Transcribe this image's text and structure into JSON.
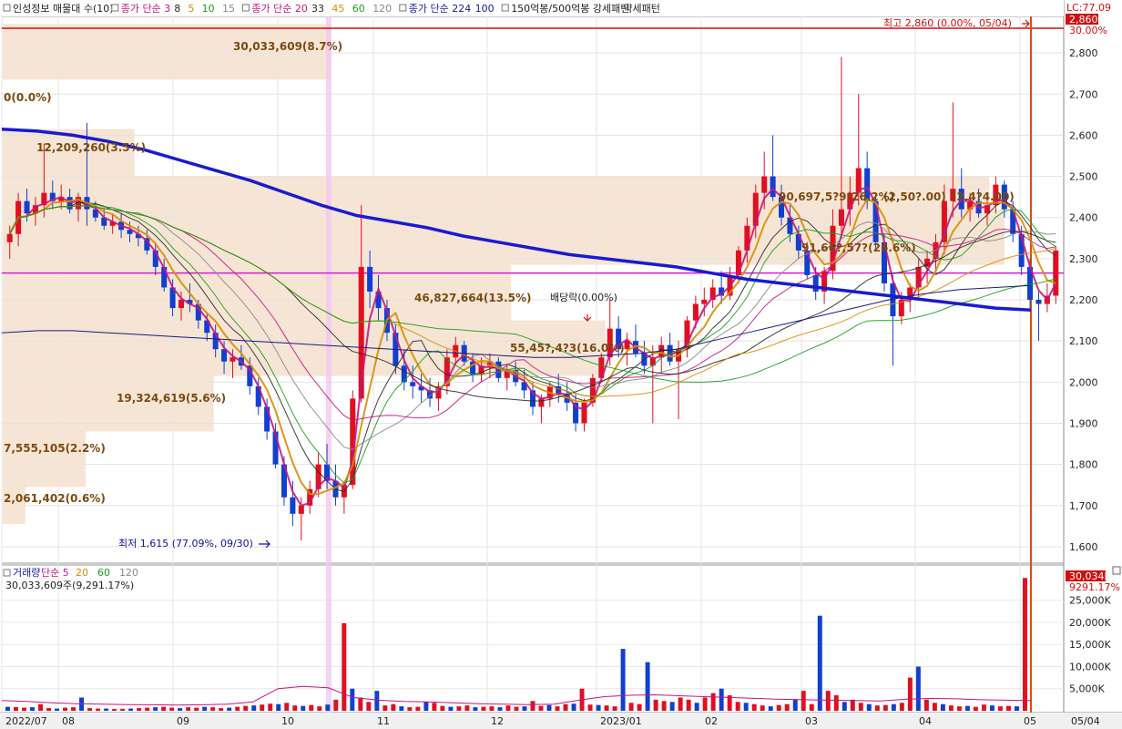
{
  "legend": {
    "main": [
      {
        "text": "인성정보 매물대 수(10)",
        "color": "#222222"
      },
      {
        "text": "종가 단순 3",
        "color": "#c8157f"
      },
      {
        "text": "8",
        "color": "#2a2a2a"
      },
      {
        "text": "5",
        "color": "#d98c00"
      },
      {
        "text": "10",
        "color": "#1a9e1a"
      },
      {
        "text": "15",
        "color": "#888888"
      },
      {
        "text": "종가 단순 20",
        "color": "#c8157f"
      },
      {
        "text": "33",
        "color": "#2a2a2a"
      },
      {
        "text": "45",
        "color": "#d98c00"
      },
      {
        "text": "60",
        "color": "#1a9e1a"
      },
      {
        "text": "120",
        "color": "#888888"
      },
      {
        "text": "종가 단순 224",
        "color": "#1a1aa0"
      },
      {
        "text": "100",
        "color": "#1a1aa0"
      },
      {
        "text": "150억봉/500억봉 강세패턴",
        "color": "#222222"
      },
      {
        "text": "약세패턴",
        "color": "#222222"
      }
    ],
    "volume": [
      {
        "text": "거래량",
        "color": "#1a1a9e"
      },
      {
        "text": "단순 5",
        "color": "#c8157f"
      },
      {
        "text": "20",
        "color": "#d98c00"
      },
      {
        "text": "60",
        "color": "#1a9e1a"
      },
      {
        "text": "120",
        "color": "#888888"
      }
    ],
    "volume_value": "30,033,609주(9,291.17%)"
  },
  "annotations": {
    "lc": "LC:77.09",
    "high_label": "최고 2,860 (0.00%, 05/04)",
    "low_label": "최저 1,615 (77.09%, 09/30)",
    "dividend": "배당락(0.00%)",
    "current_price": "2,860",
    "current_pct": "30.00%",
    "current_volume": "30,034K",
    "current_volume_pct": "9291.17%"
  },
  "chart_data": [
    {
      "type": "candlestick",
      "title": "인성정보 매물대 수(10)",
      "x_labels": [
        "2022/07",
        "08",
        "09",
        "10",
        "11",
        "12",
        "2023/01",
        "02",
        "03",
        "04",
        "05"
      ],
      "y_ticks": [
        1600,
        1700,
        1800,
        1900,
        2000,
        2100,
        2200,
        2300,
        2400,
        2500,
        2600,
        2700,
        2800
      ],
      "y_tick_labels": [
        "1,600",
        "1,700",
        "1,800",
        "1,900",
        "2,000",
        "2,100",
        "2,200",
        "2,300",
        "2,400",
        "2,500",
        "2,600",
        "2,700",
        "2,800"
      ],
      "ylim": [
        1560,
        2880
      ],
      "reference_lines": [
        {
          "name": "high",
          "value": 2860,
          "color": "#d01010"
        },
        {
          "name": "reference",
          "value": 2265,
          "color": "#d020d0"
        }
      ],
      "volume_profile": [
        {
          "label": "2,061,402(0.6%)",
          "price_from": 1655,
          "price_to": 1745,
          "share": 0.6
        },
        {
          "label": "7,555,105(2.2%)",
          "price_from": 1745,
          "price_to": 1880,
          "share": 2.2
        },
        {
          "label": "19,324,619(5.6%)",
          "price_from": 1880,
          "price_to": 2015,
          "share": 5.6
        },
        {
          "label": "55,45?,4?3(16.0%)",
          "price_from": 2015,
          "price_to": 2150,
          "share": 16.0
        },
        {
          "label": "46,827,664(13.5%)",
          "price_from": 2150,
          "price_to": 2285,
          "share": 13.5
        },
        {
          "label": "91,66?,57?(26.6%)",
          "price_from": 2285,
          "price_to": 2420,
          "share": 26.6
        },
        {
          "label": "90,697,5?9(26.2%)",
          "price_from": 2420,
          "price_to": 2500,
          "share": 26.2
        },
        {
          "label": "12,209,260(3.5%)",
          "price_from": 2500,
          "price_to": 2615,
          "share": 3.5
        },
        {
          "label": "0(0.0%)",
          "price_from": 2615,
          "price_to": 2735,
          "share": 0.0
        },
        {
          "label": "30,033,609(8.7%)",
          "price_from": 2735,
          "price_to": 2870,
          "share": 8.7
        }
      ],
      "profile_price_labels": [
        "(2,50?.00)",
        "(2,4?4.00)"
      ],
      "candles": [
        [
          2340,
          2380,
          2300,
          2360
        ],
        [
          2360,
          2460,
          2330,
          2440
        ],
        [
          2440,
          2470,
          2390,
          2410
        ],
        [
          2410,
          2450,
          2380,
          2430
        ],
        [
          2430,
          2580,
          2400,
          2460
        ],
        [
          2460,
          2490,
          2420,
          2440
        ],
        [
          2440,
          2480,
          2420,
          2450
        ],
        [
          2450,
          2470,
          2410,
          2420
        ],
        [
          2420,
          2460,
          2390,
          2450
        ],
        [
          2450,
          2630,
          2380,
          2420
        ],
        [
          2420,
          2440,
          2390,
          2400
        ],
        [
          2400,
          2420,
          2370,
          2380
        ],
        [
          2380,
          2410,
          2360,
          2390
        ],
        [
          2390,
          2410,
          2350,
          2370
        ],
        [
          2370,
          2390,
          2340,
          2360
        ],
        [
          2360,
          2380,
          2330,
          2350
        ],
        [
          2350,
          2370,
          2310,
          2320
        ],
        [
          2320,
          2340,
          2260,
          2280
        ],
        [
          2280,
          2300,
          2220,
          2230
        ],
        [
          2230,
          2250,
          2160,
          2180
        ],
        [
          2180,
          2220,
          2150,
          2200
        ],
        [
          2200,
          2240,
          2170,
          2190
        ],
        [
          2190,
          2200,
          2130,
          2150
        ],
        [
          2150,
          2170,
          2100,
          2120
        ],
        [
          2120,
          2140,
          2060,
          2080
        ],
        [
          2080,
          2100,
          2020,
          2050
        ],
        [
          2050,
          2080,
          2010,
          2060
        ],
        [
          2060,
          2090,
          2030,
          2040
        ],
        [
          2040,
          2060,
          1970,
          1990
        ],
        [
          1990,
          2010,
          1920,
          1940
        ],
        [
          1940,
          1960,
          1860,
          1880
        ],
        [
          1880,
          1900,
          1790,
          1800
        ],
        [
          1800,
          1820,
          1700,
          1720
        ],
        [
          1720,
          1760,
          1650,
          1680
        ],
        [
          1680,
          1720,
          1615,
          1700
        ],
        [
          1700,
          1760,
          1680,
          1740
        ],
        [
          1740,
          1830,
          1720,
          1800
        ],
        [
          1800,
          1850,
          1740,
          1760
        ],
        [
          1760,
          1800,
          1700,
          1720
        ],
        [
          1720,
          1760,
          1680,
          1750
        ],
        [
          1750,
          1980,
          1740,
          1960
        ],
        [
          1960,
          2430,
          1950,
          2280
        ],
        [
          2280,
          2320,
          2180,
          2220
        ],
        [
          2220,
          2260,
          2150,
          2180
        ],
        [
          2180,
          2200,
          2100,
          2120
        ],
        [
          2120,
          2140,
          2020,
          2040
        ],
        [
          2040,
          2080,
          1980,
          2000
        ],
        [
          2000,
          2040,
          1960,
          1990
        ],
        [
          1990,
          2020,
          1950,
          1980
        ],
        [
          1980,
          2010,
          1940,
          1960
        ],
        [
          1960,
          2000,
          1930,
          1990
        ],
        [
          1990,
          2080,
          1970,
          2060
        ],
        [
          2060,
          2110,
          2040,
          2090
        ],
        [
          2090,
          2100,
          2040,
          2050
        ],
        [
          2050,
          2070,
          2000,
          2020
        ],
        [
          2020,
          2060,
          2000,
          2040
        ],
        [
          2040,
          2070,
          2010,
          2050
        ],
        [
          2050,
          2060,
          2000,
          2010
        ],
        [
          2010,
          2040,
          1980,
          2030
        ],
        [
          2030,
          2050,
          1990,
          2000
        ],
        [
          2000,
          2030,
          1960,
          1980
        ],
        [
          1980,
          2000,
          1920,
          1940
        ],
        [
          1940,
          1970,
          1900,
          1960
        ],
        [
          1960,
          2000,
          1940,
          1990
        ],
        [
          1990,
          2020,
          1950,
          1970
        ],
        [
          1970,
          2000,
          1930,
          1950
        ],
        [
          1950,
          1970,
          1880,
          1900
        ],
        [
          1900,
          1960,
          1880,
          1950
        ],
        [
          1950,
          2020,
          1940,
          2010
        ],
        [
          2010,
          2070,
          2000,
          2060
        ],
        [
          2060,
          2200,
          2040,
          2130
        ],
        [
          2130,
          2160,
          2060,
          2080
        ],
        [
          2080,
          2120,
          2040,
          2100
        ],
        [
          2100,
          2140,
          2060,
          2070
        ],
        [
          2070,
          2100,
          2020,
          2040
        ],
        [
          2040,
          2090,
          1900,
          2060
        ],
        [
          2060,
          2110,
          2020,
          2090
        ],
        [
          2090,
          2120,
          2040,
          2050
        ],
        [
          2050,
          2100,
          1910,
          2080
        ],
        [
          2080,
          2160,
          2060,
          2150
        ],
        [
          2150,
          2210,
          2130,
          2190
        ],
        [
          2190,
          2230,
          2160,
          2200
        ],
        [
          2200,
          2250,
          2180,
          2230
        ],
        [
          2230,
          2270,
          2190,
          2210
        ],
        [
          2210,
          2280,
          2200,
          2260
        ],
        [
          2260,
          2330,
          2240,
          2320
        ],
        [
          2320,
          2400,
          2290,
          2380
        ],
        [
          2380,
          2480,
          2350,
          2460
        ],
        [
          2460,
          2560,
          2420,
          2500
        ],
        [
          2500,
          2600,
          2440,
          2450
        ],
        [
          2450,
          2480,
          2380,
          2400
        ],
        [
          2400,
          2430,
          2340,
          2360
        ],
        [
          2360,
          2380,
          2300,
          2320
        ],
        [
          2320,
          2340,
          2250,
          2260
        ],
        [
          2260,
          2280,
          2200,
          2220
        ],
        [
          2220,
          2280,
          2190,
          2270
        ],
        [
          2270,
          2420,
          2250,
          2380
        ],
        [
          2380,
          2790,
          2350,
          2420
        ],
        [
          2420,
          2500,
          2380,
          2460
        ],
        [
          2460,
          2700,
          2430,
          2520
        ],
        [
          2520,
          2560,
          2420,
          2440
        ],
        [
          2440,
          2460,
          2320,
          2340
        ],
        [
          2340,
          2360,
          2220,
          2240
        ],
        [
          2240,
          2260,
          2040,
          2160
        ],
        [
          2160,
          2220,
          2140,
          2200
        ],
        [
          2200,
          2240,
          2170,
          2230
        ],
        [
          2230,
          2300,
          2200,
          2280
        ],
        [
          2280,
          2320,
          2240,
          2300
        ],
        [
          2300,
          2360,
          2270,
          2340
        ],
        [
          2340,
          2480,
          2310,
          2440
        ],
        [
          2440,
          2680,
          2400,
          2470
        ],
        [
          2470,
          2520,
          2400,
          2420
        ],
        [
          2420,
          2460,
          2390,
          2440
        ],
        [
          2440,
          2470,
          2400,
          2410
        ],
        [
          2410,
          2440,
          2380,
          2430
        ],
        [
          2430,
          2500,
          2410,
          2480
        ],
        [
          2480,
          2490,
          2400,
          2420
        ],
        [
          2420,
          2440,
          2340,
          2360
        ],
        [
          2360,
          2380,
          2260,
          2280
        ],
        [
          2280,
          2300,
          2180,
          2200
        ],
        [
          2200,
          2220,
          2100,
          2190
        ],
        [
          2190,
          2240,
          2170,
          2210
        ],
        [
          2210,
          2330,
          2190,
          2320
        ]
      ],
      "series": [
        {
          "name": "종가 단순 3",
          "period": 3,
          "color": "#c8157f"
        },
        {
          "name": "8",
          "period": 8,
          "color": "#2a2a2a"
        },
        {
          "name": "5",
          "period": 5,
          "color": "#d98c00"
        },
        {
          "name": "10",
          "period": 10,
          "color": "#1a9e1a"
        },
        {
          "name": "15",
          "period": 15,
          "color": "#888888"
        },
        {
          "name": "종가 단순 20",
          "period": 20,
          "color": "#c8157f"
        },
        {
          "name": "33",
          "period": 33,
          "color": "#2a2a2a"
        },
        {
          "name": "45",
          "period": 45,
          "color": "#d98c00"
        },
        {
          "name": "60",
          "period": 60,
          "color": "#1a9e1a"
        },
        {
          "name": "종가 단순 224",
          "period": 224,
          "color": "#1a1aa0"
        }
      ],
      "ma224": [
        2615,
        2610,
        2600,
        2585,
        2565,
        2540,
        2515,
        2490,
        2460,
        2430,
        2405,
        2390,
        2375,
        2355,
        2340,
        2325,
        2310,
        2300,
        2290,
        2280,
        2265,
        2250,
        2240,
        2230,
        2220,
        2210,
        2200,
        2190,
        2180,
        2175
      ],
      "ma_long": [
        2120,
        2125,
        2125,
        2120,
        2115,
        2110,
        2105,
        2100,
        2095,
        2090,
        2085,
        2080,
        2075,
        2070,
        2065,
        2060,
        2060,
        2065,
        2070,
        2080,
        2100,
        2120,
        2140,
        2160,
        2180,
        2200,
        2215,
        2225,
        2230,
        2235
      ]
    },
    {
      "type": "bar",
      "title": "거래량",
      "y_ticks": [
        5000,
        10000,
        15000,
        20000,
        25000
      ],
      "y_tick_labels": [
        "5,000K",
        "10,000K",
        "15,000K",
        "20,000K",
        "25,000K"
      ],
      "ylim": [
        0,
        30500
      ],
      "values": [
        900,
        850,
        700,
        800,
        1500,
        600,
        500,
        700,
        800,
        3000,
        600,
        500,
        500,
        400,
        450,
        500,
        600,
        700,
        800,
        900,
        700,
        600,
        800,
        700,
        900,
        800,
        600,
        700,
        900,
        1100,
        1200,
        1400,
        1600,
        1500,
        1800,
        1200,
        1100,
        1300,
        1000,
        1400,
        2500,
        19800,
        5000,
        3000,
        2000,
        4500,
        1200,
        1500,
        1000,
        800,
        900,
        2000,
        1800,
        1100,
        900,
        1000,
        1200,
        800,
        900,
        1000,
        800,
        1200,
        900,
        1000,
        2200,
        1100,
        1300,
        1000,
        1500,
        1600,
        5000,
        1400,
        1300,
        1200,
        1000,
        14000,
        1800,
        1500,
        11000,
        2500,
        2200,
        2000,
        3000,
        2500,
        1800,
        3000,
        4000,
        5000,
        3500,
        2000,
        1800,
        1500,
        1200,
        1000,
        1300,
        1500,
        2500,
        4500,
        1500,
        21500,
        4500,
        3500,
        2000,
        2500,
        1800,
        1500,
        1200,
        1300,
        1500,
        1800,
        7500,
        10000,
        2500,
        1800,
        1500,
        1200,
        1000,
        1100,
        900,
        1400,
        1200,
        1000,
        1100,
        1000,
        30034
      ],
      "volume_ma": [
        2300,
        2100,
        1800,
        1600,
        1500,
        1400,
        1350,
        1300,
        1350,
        1500,
        2000,
        5000,
        5500,
        5200,
        3000,
        2400,
        2100,
        2000,
        1800,
        1600,
        1500,
        1400,
        1500,
        2400,
        3200,
        3500,
        3600,
        3400,
        3200,
        3000,
        2800,
        2600,
        2500,
        2400,
        2300,
        2200,
        2600,
        2800,
        2700,
        2500,
        2400,
        2300
      ]
    }
  ]
}
